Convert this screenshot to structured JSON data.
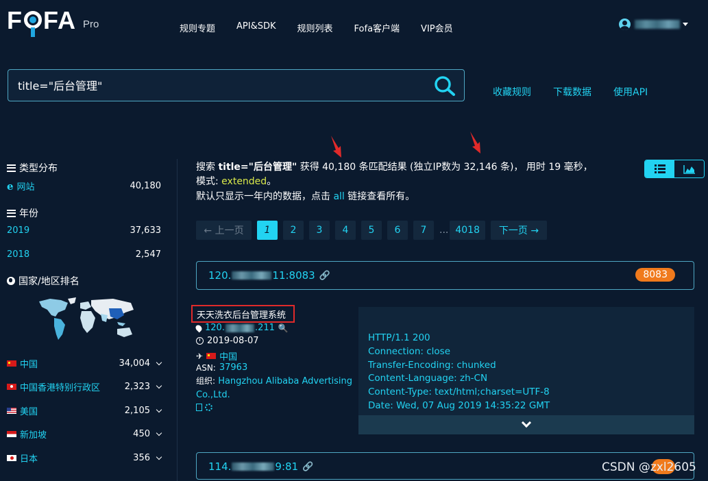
{
  "header": {
    "logo_text": "FOFA",
    "logo_suffix": "Pro",
    "nav": [
      "规则专题",
      "API&SDK",
      "规则列表",
      "Fofa客户端",
      "VIP会员"
    ]
  },
  "search": {
    "query": "title=\"后台管理\"",
    "links": [
      "收藏规则",
      "下载数据",
      "使用API"
    ]
  },
  "sidebar": {
    "type_heading": "类型分布",
    "types": [
      {
        "label": "网站",
        "count": "40,180"
      }
    ],
    "year_heading": "年份",
    "years": [
      {
        "label": "2019",
        "count": "37,633"
      },
      {
        "label": "2018",
        "count": "2,547"
      }
    ],
    "country_heading": "国家/地区排名",
    "countries": [
      {
        "label": "中国",
        "count": "34,004",
        "flag": "cn"
      },
      {
        "label": "中国香港特别行政区",
        "count": "2,323",
        "flag": "hk"
      },
      {
        "label": "美国",
        "count": "2,105",
        "flag": "us"
      },
      {
        "label": "新加坡",
        "count": "450",
        "flag": "sg"
      },
      {
        "label": "日本",
        "count": "356",
        "flag": "jp"
      }
    ]
  },
  "summary": {
    "p1": "搜索 ",
    "query": "title=\"后台管理\"",
    "p2": " 获得 40,180 条匹配结果 (独立IP数为 32,146 条)， 用时 19 毫秒，模式: ",
    "mode": "extended",
    "p3": "。",
    "note_a": "默认只显示一年内的数据，点击 ",
    "note_link": "all",
    "note_b": " 链接查看所有。"
  },
  "pagination": {
    "prev": "← 上一页",
    "pages": [
      "1",
      "2",
      "3",
      "4",
      "5",
      "6",
      "7"
    ],
    "ellipsis": "...",
    "last": "4018",
    "next": "下一页 →"
  },
  "results": [
    {
      "host_prefix": "120.",
      "host_suffix": "11:8083",
      "port": "8083",
      "title": "天天洗衣后台管理系统",
      "ip_prefix": "120.",
      "ip_suffix": ".211",
      "date": "2019-08-07",
      "country": "中国",
      "asn_label": "ASN:",
      "asn": "37963",
      "org_label": "组织:",
      "org": "Hangzhou Alibaba Advertising Co.,Ltd.",
      "http": [
        "HTTP/1.1 200",
        "Connection: close",
        "Transfer-Encoding: chunked",
        "Content-Language: zh-CN",
        "Content-Type: text/html;charset=UTF-8",
        "Date: Wed, 07 Aug 2019 14:35:22 GMT"
      ]
    },
    {
      "host_prefix": "114.",
      "host_suffix": "9:81"
    }
  ],
  "watermark": "CSDN @zxl2605",
  "colors": {
    "background": "#0b1a2e",
    "accent": "#22d3f2",
    "badge": "#f07a1c",
    "highlight_box": "#e02a2a",
    "mode_text": "#d9e84a"
  }
}
